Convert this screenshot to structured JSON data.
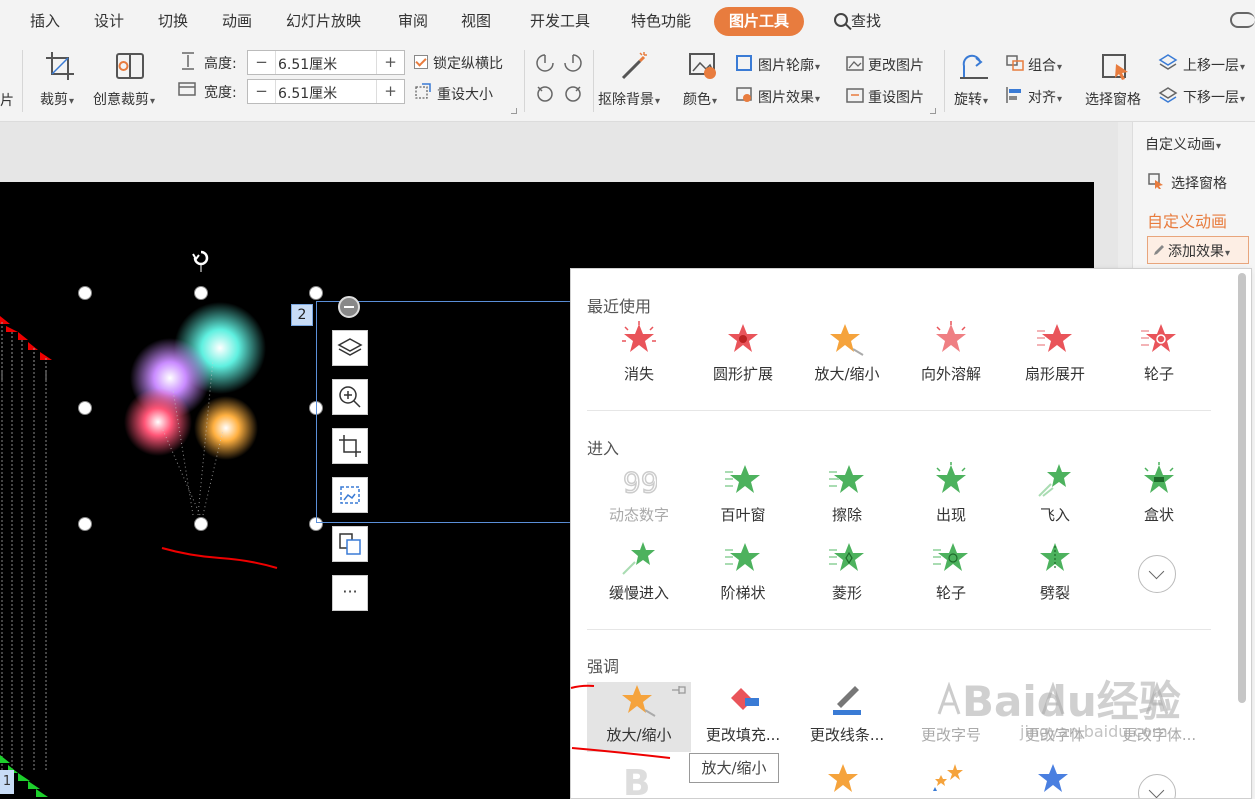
{
  "menu": {
    "items": [
      "插入",
      "设计",
      "切换",
      "动画",
      "幻灯片放映",
      "审阅",
      "视图",
      "开发工具",
      "特色功能",
      "图片工具"
    ],
    "active": "图片工具",
    "search": "查找"
  },
  "ribbon": {
    "partial_left_label": "片",
    "crop": "裁剪",
    "creative_crop": "创意裁剪",
    "height_label": "高度:",
    "height_value": "6.51厘米",
    "width_label": "宽度:",
    "width_value": "6.51厘米",
    "lock_ratio": "锁定纵横比",
    "reset_size": "重设大小",
    "remove_bg": "抠除背景",
    "color": "颜色",
    "outline": "图片轮廓",
    "effects": "图片效果",
    "change_pic": "更改图片",
    "reset_pic": "重设图片",
    "rotate": "旋转",
    "group": "组合",
    "align": "对齐",
    "selection_pane": "选择窗格",
    "bring_forward": "上移一层",
    "send_backward": "下移一层",
    "spin_minus": "−",
    "spin_plus": "+"
  },
  "right_pane": {
    "custom_anim_dropdown": "自定义动画",
    "selection_pane": "选择窗格",
    "custom_anim_title": "自定义动画",
    "add_effect": "添加效果"
  },
  "slide": {
    "object_number": "2",
    "slide_badge": "1",
    "more_dots": "···"
  },
  "effects_panel": {
    "recent": {
      "title": "最近使用",
      "items": [
        "消失",
        "圆形扩展",
        "放大/缩小",
        "向外溶解",
        "扇形展开",
        "轮子"
      ]
    },
    "entrance": {
      "title": "进入",
      "row1": [
        "动态数字",
        "百叶窗",
        "擦除",
        "出现",
        "飞入",
        "盒状"
      ],
      "row2": [
        "缓慢进入",
        "阶梯状",
        "菱形",
        "轮子",
        "劈裂"
      ]
    },
    "emphasis": {
      "title": "强调",
      "items": [
        "放大/缩小",
        "更改填充...",
        "更改线条...",
        "更改字号",
        "更改字体",
        "更改字体..."
      ]
    },
    "tooltip": "放大/缩小",
    "colors": {
      "exit_red": "#e9545a",
      "entrance_green": "#4db25e",
      "emphasis_orange": "#f5a33c",
      "accent": "#e87c3e"
    }
  },
  "watermark": {
    "brand": "Baidu经验",
    "url": "jingyan.baidu.com"
  }
}
